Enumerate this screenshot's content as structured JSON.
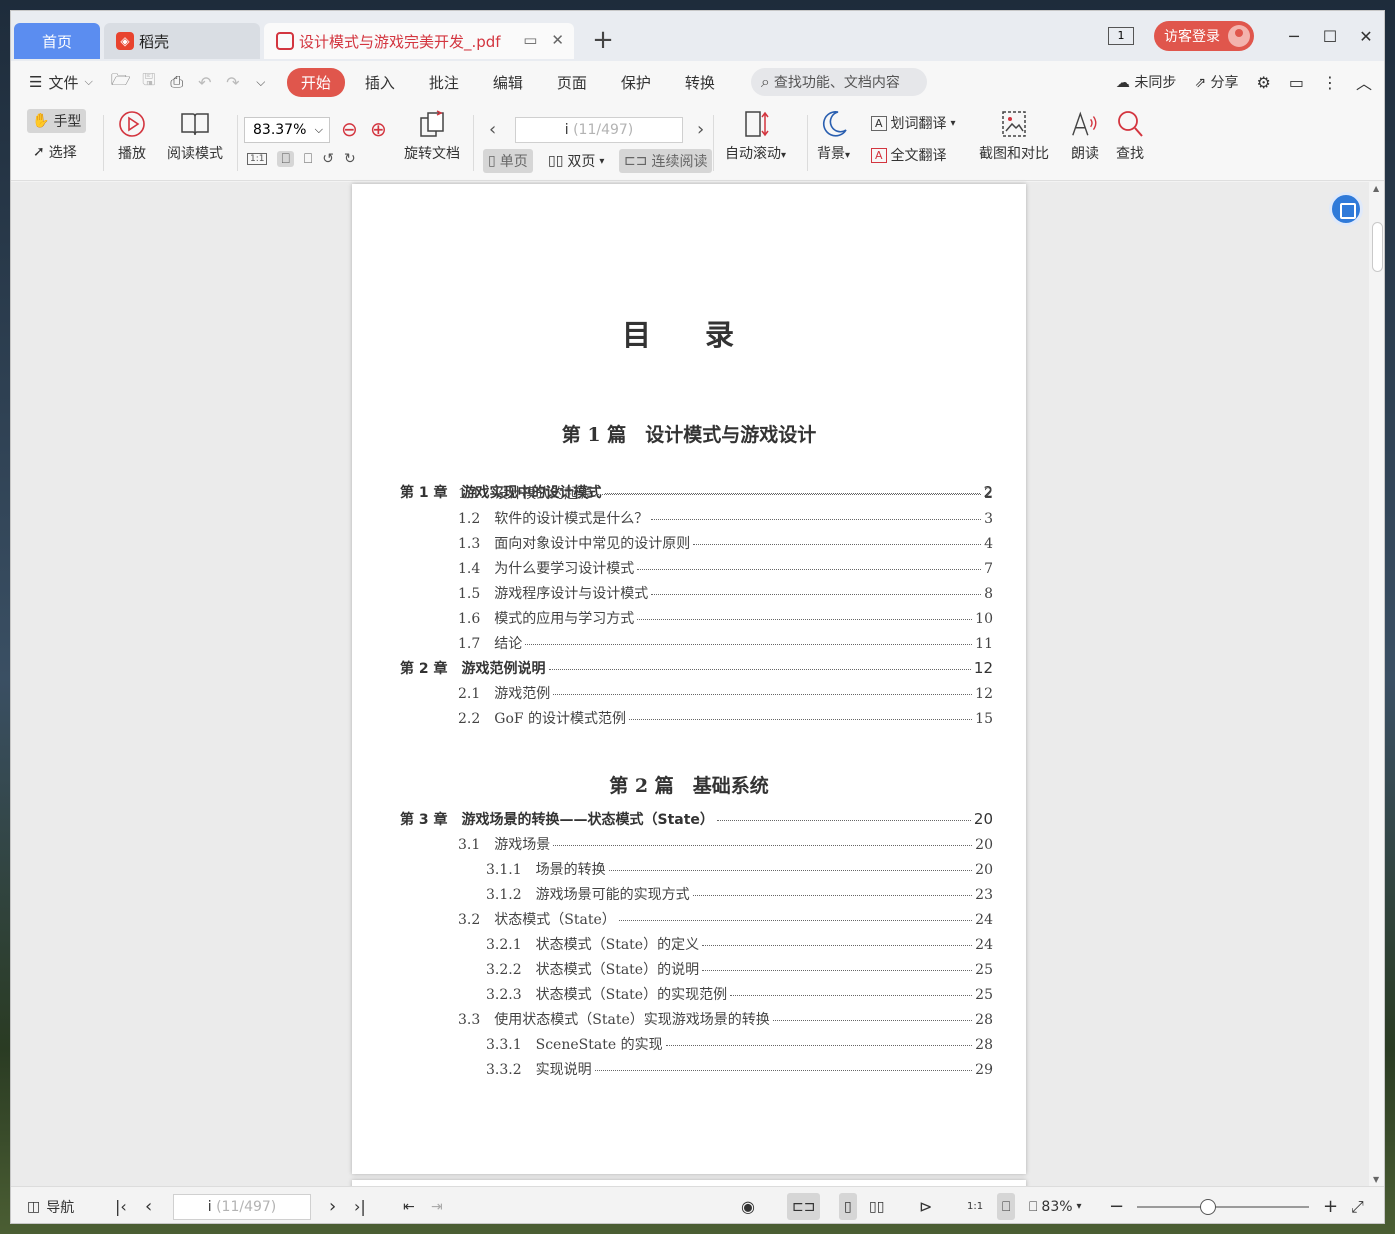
{
  "tabs": {
    "home": "首页",
    "daoke": "稻壳",
    "document": "设计模式与游戏完美开发_.pdf"
  },
  "titlebar": {
    "page_badge": "1",
    "login": "访客登录"
  },
  "menu": {
    "file": "文件",
    "items": [
      "开始",
      "插入",
      "批注",
      "编辑",
      "页面",
      "保护",
      "转换"
    ],
    "search_placeholder": "查找功能、文档内容",
    "sync": "未同步",
    "share": "分享"
  },
  "ribbon": {
    "hand": "手型",
    "select": "选择",
    "play": "播放",
    "read_mode": "阅读模式",
    "zoom": "83.37%",
    "rotate": "旋转文档",
    "page_current": "i",
    "page_total": "(11/497)",
    "single": "单页",
    "double": "双页",
    "continuous": "连续阅读",
    "auto_scroll": "自动滚动",
    "background": "背景",
    "word_translate": "划词翻译",
    "full_translate": "全文翻译",
    "screenshot": "截图和对比",
    "read_aloud": "朗读",
    "find": "查找"
  },
  "doc": {
    "title": "目 录",
    "parts": [
      "第 1 篇　设计模式与游戏设计",
      "第 2 篇　基础系统"
    ],
    "toc": [
      {
        "label": "第 1 章　游戏实现中的设计模式",
        "page": "2"
      },
      {
        "label": "1.1　设计模式的起源",
        "page": "2"
      },
      {
        "label": "1.2　软件的设计模式是什么？",
        "page": "3"
      },
      {
        "label": "1.3　面向对象设计中常见的设计原则",
        "page": "4"
      },
      {
        "label": "1.4　为什么要学习设计模式",
        "page": "7"
      },
      {
        "label": "1.5　游戏程序设计与设计模式",
        "page": "8"
      },
      {
        "label": "1.6　模式的应用与学习方式",
        "page": "10"
      },
      {
        "label": "1.7　结论",
        "page": "11"
      },
      {
        "label": "第 2 章　游戏范例说明",
        "page": "12"
      },
      {
        "label": "2.1　游戏范例",
        "page": "12"
      },
      {
        "label": "2.2　GoF 的设计模式范例",
        "page": "15"
      },
      {
        "label": "第 3 章　游戏场景的转换——状态模式（State）",
        "page": "20"
      },
      {
        "label": "3.1　游戏场景",
        "page": "20"
      },
      {
        "label": "3.1.1　场景的转换",
        "page": "20"
      },
      {
        "label": "3.1.2　游戏场景可能的实现方式",
        "page": "23"
      },
      {
        "label": "3.2　状态模式（State）",
        "page": "24"
      },
      {
        "label": "3.2.1　状态模式（State）的定义",
        "page": "24"
      },
      {
        "label": "3.2.2　状态模式（State）的说明",
        "page": "25"
      },
      {
        "label": "3.2.3　状态模式（State）的实现范例",
        "page": "25"
      },
      {
        "label": "3.3　使用状态模式（State）实现游戏场景的转换",
        "page": "28"
      },
      {
        "label": "3.3.1　SceneState 的实现",
        "page": "28"
      },
      {
        "label": "3.3.2　实现说明",
        "page": "29"
      }
    ]
  },
  "status": {
    "nav": "导航",
    "page_current": "i",
    "page_total": "(11/497)",
    "zoom": "83%"
  },
  "colors": {
    "accent": "#e0564c",
    "home_tab": "#5b8df0",
    "doc_tab_text": "#d3353f",
    "float_button": "#2f7ad9"
  }
}
